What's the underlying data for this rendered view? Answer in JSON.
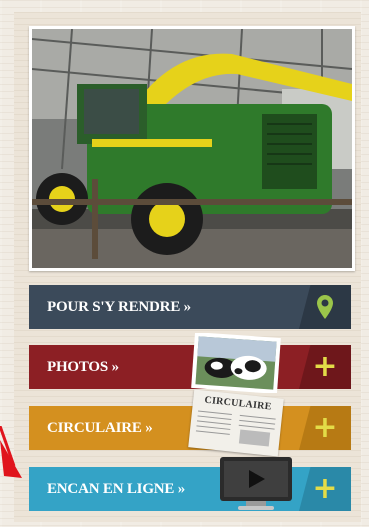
{
  "buttons": {
    "route": {
      "label": "POUR S'Y RENDRE »",
      "icon": "map-pin-icon",
      "color": "#3b4a5a"
    },
    "photos": {
      "label": "PHOTOS »",
      "icon": "plus-icon",
      "color": "#8c1f24"
    },
    "circulaire": {
      "label": "CIRCULAIRE »",
      "icon": "plus-icon",
      "color": "#d4901f"
    },
    "encan": {
      "label": "ENCAN EN LIGNE »",
      "icon": "plus-icon",
      "color": "#34a3c6"
    }
  },
  "circulaire_thumb_text": "CIRCULAIRE",
  "plus_glyph": "+",
  "accent": "#e3dc48"
}
